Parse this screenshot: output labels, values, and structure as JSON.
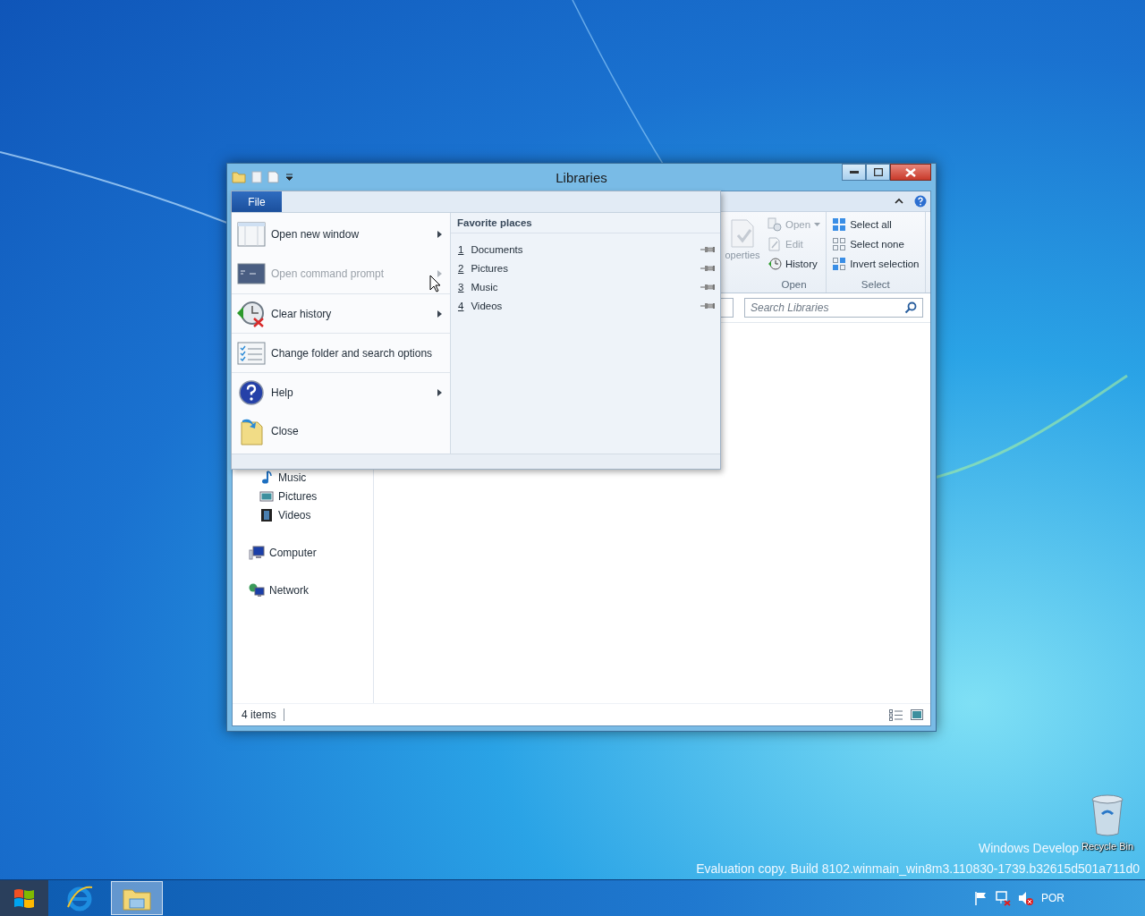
{
  "window": {
    "title": "Libraries"
  },
  "file_menu": {
    "tab": "File",
    "commands": [
      {
        "label": "Open new window",
        "kind": "window",
        "disabled": false,
        "submenu": true,
        "separator": false
      },
      {
        "label": "Open command prompt",
        "kind": "prompt",
        "disabled": true,
        "submenu": true,
        "separator": false
      },
      {
        "label": "Clear history",
        "kind": "history",
        "disabled": false,
        "submenu": true,
        "separator": true
      },
      {
        "label": "Change folder and search options",
        "kind": "options",
        "disabled": false,
        "submenu": false,
        "separator": true
      },
      {
        "label": "Help",
        "kind": "help",
        "disabled": false,
        "submenu": true,
        "separator": true
      },
      {
        "label": "Close",
        "kind": "close",
        "disabled": false,
        "submenu": false,
        "separator": false
      }
    ],
    "favorites_title": "Favorite places",
    "favorites": [
      {
        "number": "1",
        "name": "Documents"
      },
      {
        "number": "2",
        "name": "Pictures"
      },
      {
        "number": "3",
        "name": "Music"
      },
      {
        "number": "4",
        "name": "Videos"
      }
    ]
  },
  "ribbon": {
    "partial_command": "operties",
    "groups": [
      {
        "label": "Open",
        "commands": [
          {
            "label": "Open",
            "kind": "open",
            "disabled": true,
            "dropdown": true
          },
          {
            "label": "Edit",
            "kind": "edit",
            "disabled": true,
            "dropdown": false
          },
          {
            "label": "History",
            "kind": "history",
            "disabled": false,
            "dropdown": false
          }
        ]
      },
      {
        "label": "Select",
        "commands": [
          {
            "label": "Select all",
            "kind": "select-all",
            "disabled": false,
            "dropdown": false
          },
          {
            "label": "Select none",
            "kind": "select-none",
            "disabled": false,
            "dropdown": false
          },
          {
            "label": "Invert selection",
            "kind": "invert",
            "disabled": false,
            "dropdown": false
          }
        ]
      }
    ]
  },
  "search": {
    "placeholder": "Search Libraries"
  },
  "nav_pane": {
    "library_items": [
      {
        "label": "Music",
        "kind": "music"
      },
      {
        "label": "Pictures",
        "kind": "pictures"
      },
      {
        "label": "Videos",
        "kind": "videos"
      }
    ],
    "items": [
      {
        "label": "Computer",
        "kind": "computer"
      },
      {
        "label": "Network",
        "kind": "network"
      }
    ]
  },
  "status_bar": {
    "item_count": "4 items"
  },
  "desktop": {
    "edition": "Windows Develop",
    "build": "Evaluation copy. Build 8102.winmain_win8m3.110830-1739.b32615d501a711d0",
    "icons": [
      {
        "label": "Recycle Bin",
        "kind": "recycle-bin"
      }
    ]
  },
  "taskbar": {
    "apps": [
      {
        "kind": "browser",
        "active": false
      },
      {
        "kind": "explorer",
        "active": true
      }
    ],
    "language": "POR"
  }
}
